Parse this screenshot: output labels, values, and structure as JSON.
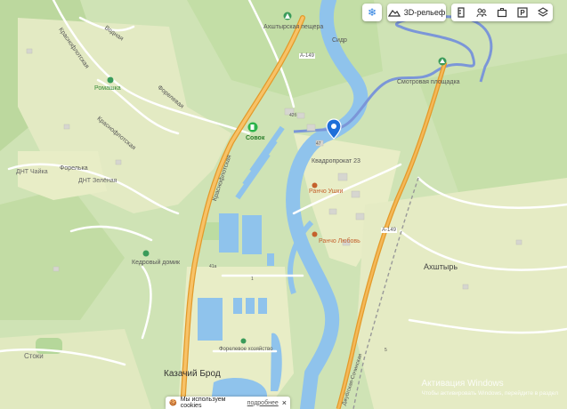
{
  "toolbar": {
    "snow_icon": "snowflake-icon",
    "relief_label": "3D-рельеф",
    "tools": [
      "ruler-icon",
      "people-icon",
      "briefcase-icon",
      "parking-icon",
      "layers-icon"
    ]
  },
  "labels": {
    "akhshtyrskaya": "Ахштырская пещера",
    "road_a149_top": "А-149",
    "smotrovaya": "Смотровая площадка",
    "sidr": "Сидр",
    "krasnoflotskaya": "Краснофлотская",
    "vodnaya": "Водная",
    "romashka": "Ромашка",
    "forelevaya": "Форелевая",
    "krasnoflotskaya2": "Краснофлотская",
    "sovok": "Совок",
    "num_42b": "42б",
    "num_47": "47",
    "kvadroprokat": "Квадропрокат 23",
    "rancho_ushki": "Ранчо Ушки",
    "dnt_chaika": "ДНТ Чайка",
    "forelka": "Форелька",
    "dnt_zelenaya": "ДНТ Зелёная",
    "krasnoflotskaya3": "Краснофлотская",
    "rancho_lyubov": "Ранчо Любовь",
    "road_a149_mid": "А-149",
    "kedrovy_domik": "Кедровый домик",
    "akhshtyr": "Ахштырь",
    "num_41a": "41а",
    "num_1": "1",
    "forelevoe": "Форелевое хозяйство",
    "kazachiy": "Казачий Брод",
    "stoki": "Стоки",
    "dzhubgskaya": "Джубгская-Сочинская",
    "num_5": "5"
  },
  "cookie": {
    "text": "Мы используем cookies",
    "link": "подробнее",
    "close": "×"
  },
  "watermark": {
    "line1": "Активация Windows",
    "line2": "Чтобы активировать Windows, перейдите в раздел"
  },
  "colors": {
    "forest": "#b9d89a",
    "meadow": "#e8edc6",
    "river": "#8fc3ec",
    "road_main": "#f2a433",
    "road_minor": "#ffffff",
    "route": "#7b96d8",
    "pin": "#1e6fd9"
  }
}
